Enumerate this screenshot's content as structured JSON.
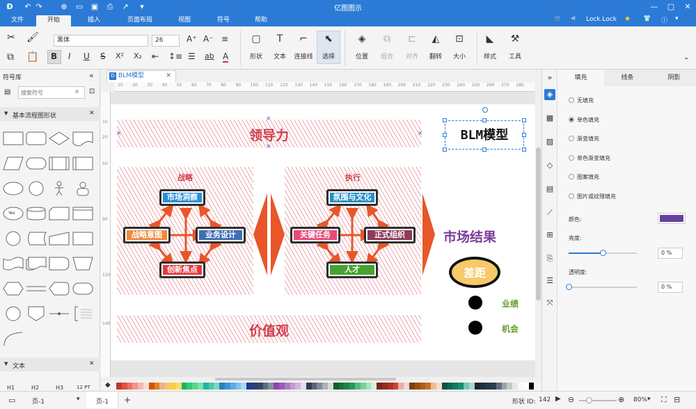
{
  "app_title": "亿图图示",
  "menu": [
    {
      "label": "文件"
    },
    {
      "label": "开始"
    },
    {
      "label": "插入"
    },
    {
      "label": "页面布局"
    },
    {
      "label": "视图"
    },
    {
      "label": "符号"
    },
    {
      "label": "帮助"
    }
  ],
  "user": {
    "name": "Lock.Lock"
  },
  "ribbon": {
    "font_name": "黑体",
    "font_size": "26",
    "tools": [
      {
        "label": "形状",
        "icon": "rectangle-icon"
      },
      {
        "label": "文本",
        "icon": "text-t-icon"
      },
      {
        "label": "连接线",
        "icon": "connector-icon"
      },
      {
        "label": "选择",
        "icon": "pointer-icon"
      },
      {
        "label": "位置",
        "icon": "layers-icon"
      },
      {
        "label": "组合",
        "icon": "group-icon"
      },
      {
        "label": "对齐",
        "icon": "align-icon"
      },
      {
        "label": "翻转",
        "icon": "flip-icon"
      },
      {
        "label": "大小",
        "icon": "resize-icon"
      },
      {
        "label": "样式",
        "icon": "paint-bucket-icon"
      },
      {
        "label": "工具",
        "icon": "tools-icon"
      }
    ]
  },
  "library": {
    "title": "符号库",
    "search_placeholder": "搜索符号",
    "section1": "基本流程图形状",
    "section2": "文本",
    "text_samples": [
      "H1",
      "H2",
      "H3",
      "12 PT"
    ],
    "yes_label": "Yes"
  },
  "document": {
    "tab": "BLM模型"
  },
  "ruler": [
    "10",
    "20",
    "30",
    "40",
    "50",
    "60",
    "70",
    "80",
    "90",
    "100",
    "110",
    "120",
    "130",
    "140",
    "150",
    "160",
    "170",
    "180",
    "190",
    "200",
    "210",
    "220",
    "230",
    "240",
    "250",
    "260",
    "270",
    "280"
  ],
  "diagram": {
    "top_band": "领导力",
    "bottom_band": "价值观",
    "strategy_title": "战略",
    "execution_title": "执行",
    "strategy_boxes": {
      "top": "市场洞察",
      "left": "战略意图",
      "right": "业务设计",
      "bottom": "创新焦点"
    },
    "execution_boxes": {
      "top": "氛围与文化",
      "left": "关键任务",
      "right": "正式组织",
      "bottom": "人才"
    },
    "result_title": "市场结果",
    "gap_label": "差距",
    "dot1": "业绩",
    "dot2": "机会",
    "model_title": "BLM模型"
  },
  "right_panel": {
    "tabs": [
      "填充",
      "线条",
      "阴影"
    ],
    "fill_options": [
      "无填充",
      "单色填充",
      "渐变填充",
      "单色渐变填充",
      "图案填充",
      "图片或纹理填充"
    ],
    "selected_fill": 1,
    "color_label": "颜色:",
    "brightness_label": "亮度:",
    "transparency_label": "透明度:",
    "brightness_value": "0 %",
    "transparency_value": "0 %",
    "brightness_fraction": 0.5,
    "transparency_fraction": 0.0,
    "fill_color": "#6b3fa0"
  },
  "status": {
    "page_left": "页-1",
    "page_tab": "页-1",
    "shape_id_label": "形状 ID:",
    "shape_id": "142",
    "zoom": "80%"
  },
  "colors": {
    "titlebar": "#2b7ad6",
    "box_blue": "#2a8fd8",
    "box_orange": "#f08a3e",
    "box_indigo": "#3f6fb3",
    "box_red": "#e6393c",
    "box_teal": "#2a8fc6",
    "box_pink": "#e64b7a",
    "box_maroon": "#8e3b5a",
    "box_green": "#46a32f",
    "arrow_orange": "#e8562a",
    "band_text": "#d23c4a",
    "result_purple": "#7a3f9a",
    "dot_label_green": "#6a9b2f"
  }
}
